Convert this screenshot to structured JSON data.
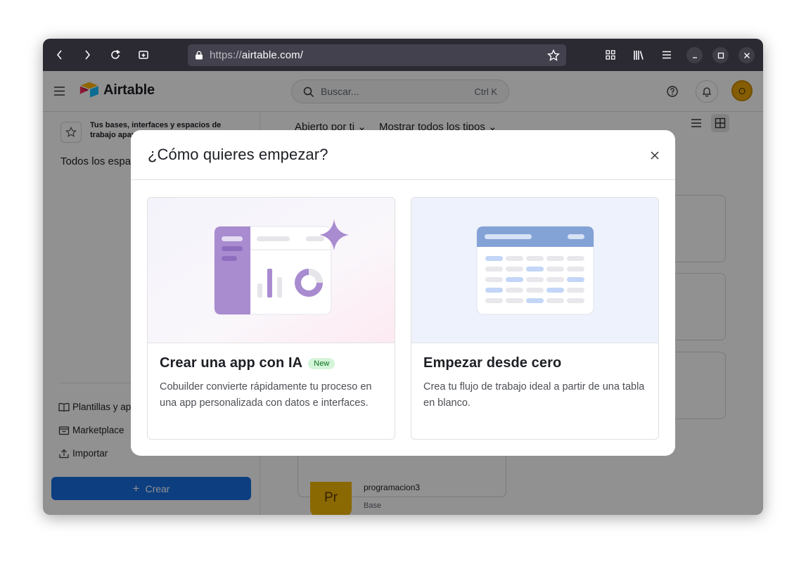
{
  "browser": {
    "url_scheme": "https://",
    "url_host": "airtable.com/"
  },
  "app": {
    "logo_text": "Airtable",
    "search_placeholder": "Buscar...",
    "search_shortcut": "Ctrl K",
    "avatar_initial": "O",
    "brand_color": "#166ee1"
  },
  "sidebar": {
    "hint_text": "Tus bases, interfaces y espacios de trabajo aparecerán",
    "workspace_title": "Todos los espa",
    "links": [
      {
        "label": "Plantillas y ap",
        "icon": "book-icon"
      },
      {
        "label": "Marketplace",
        "icon": "marketplace-icon"
      },
      {
        "label": "Importar",
        "icon": "upload-icon"
      }
    ],
    "create_label": "Crear"
  },
  "main": {
    "filter_opened": "Abierto por ti",
    "filter_types": "Mostrar todos los tipos",
    "base": {
      "initials": "Pr",
      "name": "programacion3",
      "type": "Base"
    }
  },
  "modal": {
    "title": "¿Cómo quieres empezar?",
    "options": [
      {
        "title": "Crear una app con IA",
        "badge": "New",
        "description": "Cobuilder convierte rápidamente tu proceso en una app personalizada con datos e interfaces."
      },
      {
        "title": "Empezar desde cero",
        "badge": "",
        "description": "Crea tu flujo de trabajo ideal a partir de una tabla en blanco."
      }
    ]
  }
}
